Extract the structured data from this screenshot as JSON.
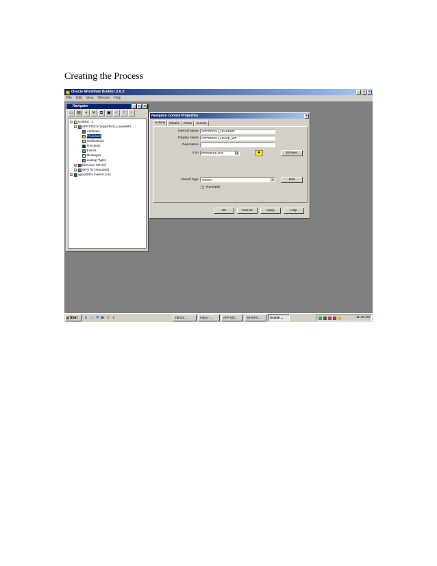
{
  "heading": "Creating the Process",
  "app": {
    "title": "Oracle Workflow Builder 2.6.3",
    "menu": [
      "File",
      "Edit",
      "View",
      "Window",
      "Help"
    ]
  },
  "navigator": {
    "title": "Navigator",
    "tree": [
      {
        "label": "Untitled - 2",
        "icon": "workspace-icon"
      },
      {
        "label": "APPSTECH (AppsTech_LeaveWF)",
        "icon": "item-type-icon"
      },
      {
        "label": "Attributes",
        "icon": "attributes-icon"
      },
      {
        "label": "Processes",
        "icon": "processes-icon",
        "selected": true
      },
      {
        "label": "Notifications",
        "icon": "notifications-icon"
      },
      {
        "label": "Functions",
        "icon": "functions-icon"
      },
      {
        "label": "Events",
        "icon": "events-icon"
      },
      {
        "label": "Messages",
        "icon": "messages-icon"
      },
      {
        "label": "Lookup Types",
        "icon": "lookup-types-icon"
      },
      {
        "label": "Directory Service",
        "icon": "directory-icon"
      },
      {
        "label": "WFSTD (Standard)",
        "icon": "item-type-icon"
      },
      {
        "label": "apps@dev.inatech.com",
        "icon": "database-icon"
      }
    ]
  },
  "dialog": {
    "title": "Navigator Control Properties",
    "tabs": [
      "Activity",
      "Details",
      "Roles",
      "Access"
    ],
    "internal_name_label": "Internal Name",
    "internal_name_value": "APPSTECH_LEAVEWF",
    "display_name_label": "Display Name",
    "display_name_value": "APPSTECH_LEAVE_WF",
    "description_label": "Description",
    "description_value": "",
    "icon_label": "Icon",
    "icon_value": "PROCESS.ICO",
    "browse_label": "Browse",
    "result_type_label": "Result Type",
    "result_type_value": "<None>",
    "edit_label": "Edit",
    "runnable_label": "Runnable",
    "runnable_checked": true,
    "ok_label": "OK",
    "cancel_label": "Cancel",
    "apply_label": "Apply",
    "help_label": "Help"
  },
  "taskbar": {
    "start_label": "Start",
    "tasks": [
      "Yahoo! ...",
      "Inbox - ...",
      "APPS@...",
      "WorkFlo...",
      "Oracle ..."
    ],
    "clock": "11:48 AM"
  },
  "colors": {
    "desktop": "#808080",
    "title_active": "#0a246a",
    "face": "#d4d0c8"
  }
}
